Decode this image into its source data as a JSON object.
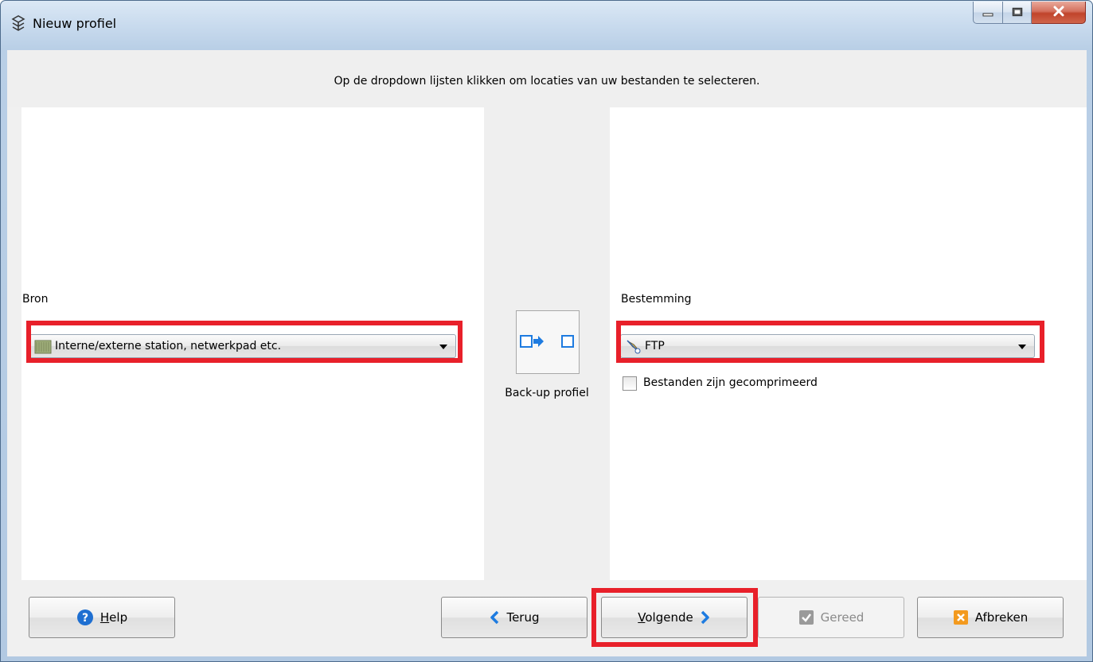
{
  "window": {
    "title": "Nieuw profiel",
    "controls": [
      "minimize-icon",
      "maximize-icon",
      "close-icon"
    ]
  },
  "instruction": "Op de dropdown lijsten klikken om locaties van uw bestanden te selecteren.",
  "source": {
    "label": "Bron",
    "selected": "Interne/externe station, netwerkpad etc.",
    "icon": "drive-icon"
  },
  "middle": {
    "caption": "Back-up profiel",
    "icon": "backup-direction-icon"
  },
  "destination": {
    "label": "Bestemming",
    "selected": "FTP",
    "icon": "ftp-icon",
    "compressed_checkbox_label": "Bestanden zijn gecomprimeerd",
    "compressed_checked": false
  },
  "buttons": {
    "help": {
      "label": "elp",
      "mnemonic": "H",
      "icon": "help-icon"
    },
    "back": {
      "label": "Terug",
      "icon": "chevron-left-icon"
    },
    "next": {
      "label": "olgende",
      "mnemonic": "V",
      "icon": "chevron-right-icon"
    },
    "finish": {
      "label": "Gereed",
      "icon": "check-icon",
      "disabled": true
    },
    "cancel": {
      "label": "Afbreken",
      "icon": "cancel-icon"
    }
  },
  "colors": {
    "highlight": "#e8202a",
    "accent_blue": "#1e7be0",
    "cancel_orange": "#f39a1e"
  }
}
